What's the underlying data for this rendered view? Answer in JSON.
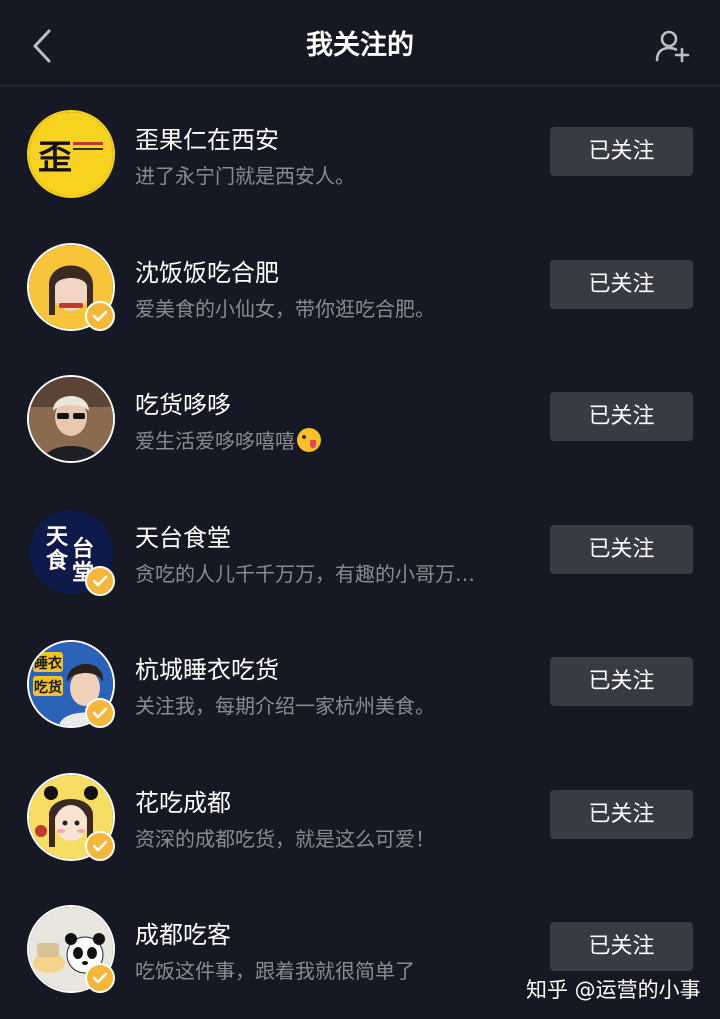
{
  "header": {
    "title": "我关注的",
    "back_icon": "chevron-left-icon",
    "add_icon": "add-user-icon"
  },
  "follow_label": "已关注",
  "accounts": [
    {
      "name": "歪果仁在西安",
      "bio": "进了永宁门就是西安人。",
      "verified": false,
      "avatar_text": "歪"
    },
    {
      "name": "沈饭饭吃合肥",
      "bio": "爱美食的小仙女，带你逛吃合肥。",
      "verified": true
    },
    {
      "name": "吃货哆哆",
      "bio": "爱生活爱哆哆嘻嘻",
      "verified": false,
      "emoji": "squinting-tongue-emoji"
    },
    {
      "name": "天台食堂",
      "bio": "贪吃的人儿千千万万，有趣的小哥万…",
      "verified": true,
      "avatar_text": "天食台堂"
    },
    {
      "name": "杭城睡衣吃货",
      "bio": "关注我，每期介绍一家杭州美食。",
      "verified": true,
      "avatar_text": "睡衣吃货"
    },
    {
      "name": "花吃成都",
      "bio": "资深的成都吃货，就是这么可爱！",
      "verified": true
    },
    {
      "name": "成都吃客",
      "bio": "吃饭这件事，跟着我就很简单了",
      "verified": true
    }
  ],
  "watermark": "知乎 @运营的小事",
  "colors": {
    "background": "#161823",
    "button": "#393b44",
    "bio_text": "#8a8b91",
    "verified_badge": "#f5b73b"
  }
}
